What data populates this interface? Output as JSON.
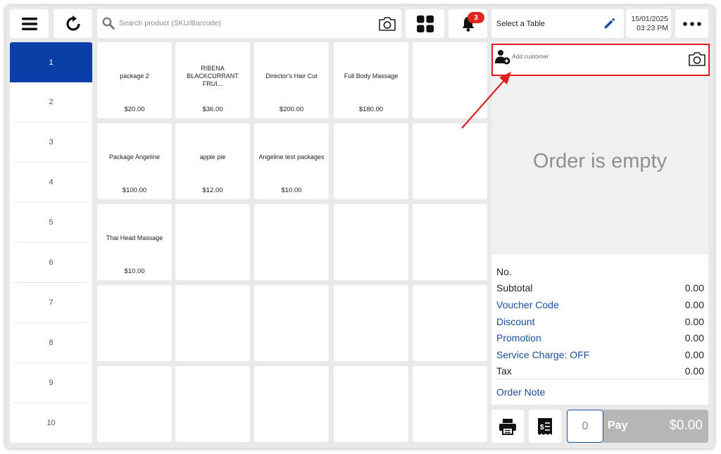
{
  "toolbar": {
    "menu_icon": "hamburger-menu-icon",
    "refresh_icon": "refresh-icon",
    "search_placeholder": "Search product (SKU/Barcode)",
    "camera_icon": "camera-icon",
    "grid_icon": "grid-view-icon",
    "notification_count": "3",
    "table_label": "Select a Table",
    "date": "15/01/2025",
    "time": "03:23 PM",
    "more_icon": "more-options-icon"
  },
  "sidebar": {
    "pages": [
      "1",
      "2",
      "3",
      "4",
      "5",
      "6",
      "7",
      "8",
      "9",
      "10"
    ],
    "active_index": 0
  },
  "products": [
    {
      "name": "package 2",
      "price": "$20.00"
    },
    {
      "name": "RIBENA BLACKCURRANT FRUI...",
      "price": "$36.00"
    },
    {
      "name": "Director's Hair Cut",
      "price": "$200.00"
    },
    {
      "name": "Full Body Massage",
      "price": "$180.00"
    },
    {
      "name": "",
      "price": ""
    },
    {
      "name": "Package Angeline",
      "price": "$100.00"
    },
    {
      "name": "apple pie",
      "price": "$12.00"
    },
    {
      "name": "Angeline test packages",
      "price": "$10.00"
    },
    {
      "name": "",
      "price": ""
    },
    {
      "name": "",
      "price": ""
    },
    {
      "name": "Thai Head Massage",
      "price": "$10.00"
    }
  ],
  "order": {
    "add_customer_label": "Add customer",
    "empty_message": "Order is empty",
    "summary": [
      {
        "label": "No.",
        "value": "",
        "link": false
      },
      {
        "label": "Subtotal",
        "value": "0.00",
        "link": false
      },
      {
        "label": "Voucher Code",
        "value": "0.00",
        "link": true
      },
      {
        "label": "Discount",
        "value": "0.00",
        "link": true
      },
      {
        "label": "Promotion",
        "value": "0.00",
        "link": true
      },
      {
        "label": "Service Charge: OFF",
        "value": "0.00",
        "link": true
      },
      {
        "label": "Tax",
        "value": "0.00",
        "link": false
      }
    ],
    "order_note_label": "Order Note",
    "quantity": "0",
    "pay_label": "Pay",
    "pay_amount": "$0.00"
  },
  "colors": {
    "accent_blue": "#0b3fa8",
    "link_blue": "#1b4f9c",
    "annotation_red": "#e11d1d",
    "badge_red": "#e0261e"
  }
}
